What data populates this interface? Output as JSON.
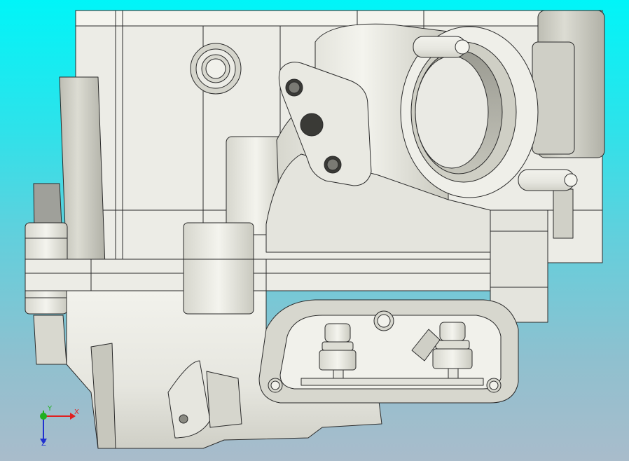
{
  "viewport": {
    "background_top": "#00f5f8",
    "background_bottom": "#a9bccb",
    "model_fill": "#e9e9e3",
    "model_edge": "#2a2a2a"
  },
  "triad": {
    "x_label": "X",
    "y_label": "Y",
    "z_label": "Z",
    "x_color": "#e02020",
    "y_color": "#20b020",
    "z_color": "#2030d0"
  }
}
